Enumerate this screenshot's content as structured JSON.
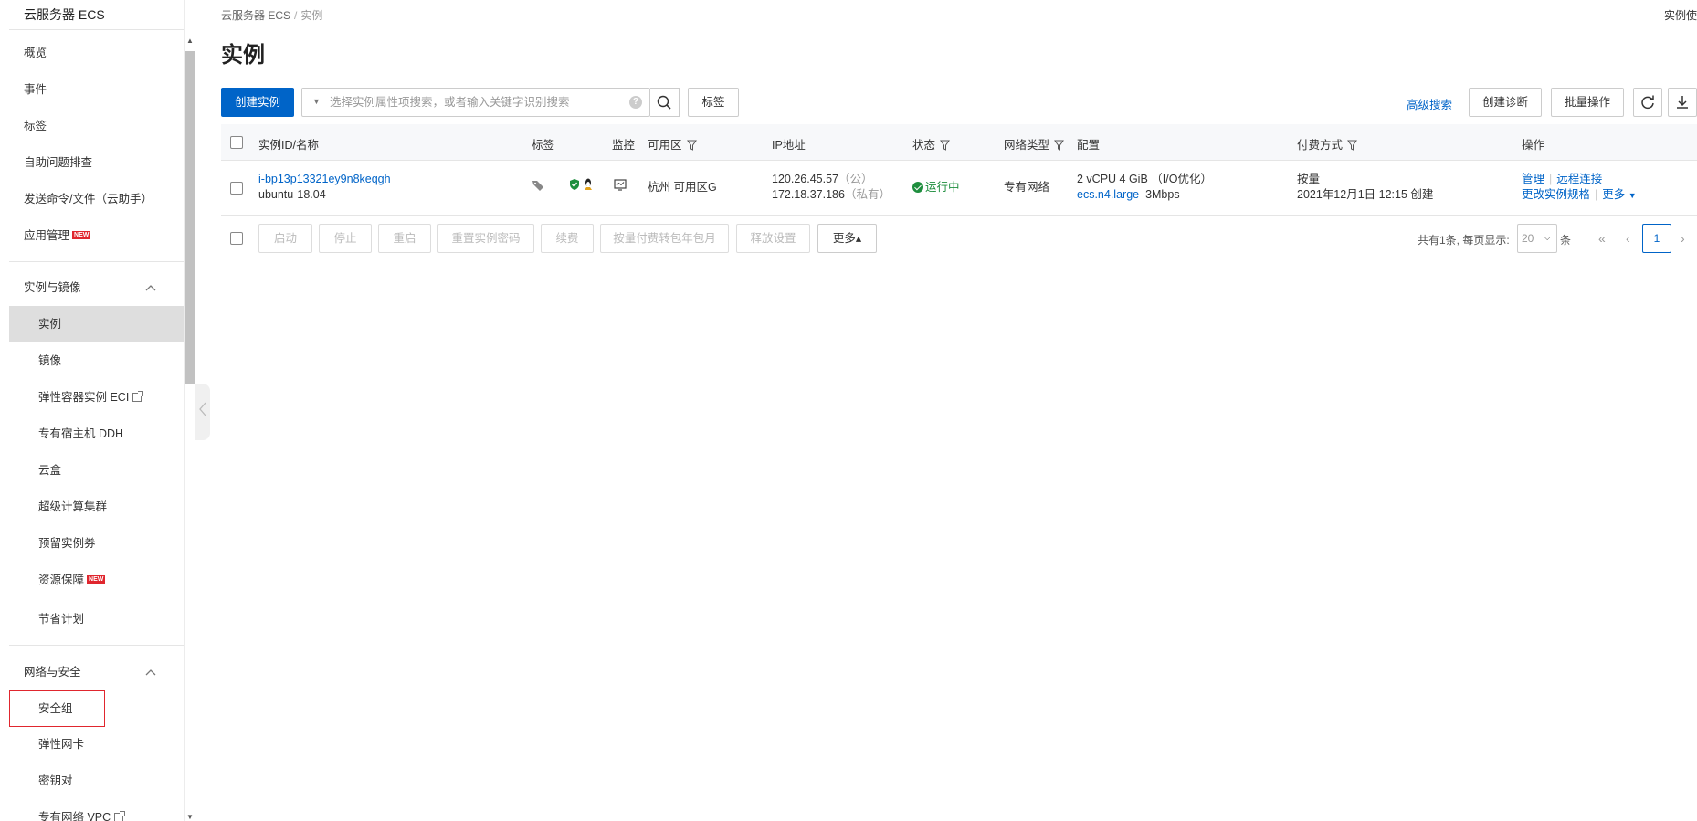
{
  "sidebar": {
    "title": "云服务器 ECS",
    "top_items": [
      {
        "label": "概览"
      },
      {
        "label": "事件"
      },
      {
        "label": "标签"
      },
      {
        "label": "自助问题排查"
      },
      {
        "label": "发送命令/文件（云助手）"
      },
      {
        "label": "应用管理",
        "badge": "NEW"
      }
    ],
    "group_instances": {
      "label": "实例与镜像",
      "items": [
        {
          "label": "实例",
          "active": true
        },
        {
          "label": "镜像"
        },
        {
          "label": "弹性容器实例 ECI",
          "external": true
        },
        {
          "label": "专有宿主机 DDH"
        },
        {
          "label": "云盒"
        },
        {
          "label": "超级计算集群"
        },
        {
          "label": "预留实例券"
        },
        {
          "label": "资源保障",
          "badge": "NEW"
        },
        {
          "label": "节省计划"
        }
      ]
    },
    "group_network": {
      "label": "网络与安全",
      "items": [
        {
          "label": "安全组",
          "highlighted": true
        },
        {
          "label": "弹性网卡"
        },
        {
          "label": "密钥对"
        },
        {
          "label": "专有网络 VPC",
          "external": true
        }
      ]
    }
  },
  "breadcrumb": {
    "root": "云服务器 ECS",
    "separator": "/",
    "current": "实例"
  },
  "top_right_text": "实例使",
  "page_title": "实例",
  "toolbar": {
    "create_label": "创建实例",
    "search_placeholder": "选择实例属性项搜索，或者输入关键字识别搜索",
    "tag_label": "标签",
    "advanced_search_label": "高级搜索",
    "diagnose_label": "创建诊断",
    "batch_label": "批量操作"
  },
  "table": {
    "columns": {
      "id_name": "实例ID/名称",
      "tags": "标签",
      "monitor": "监控",
      "zone": "可用区",
      "ip": "IP地址",
      "status": "状态",
      "network": "网络类型",
      "config": "配置",
      "billing": "付费方式",
      "actions": "操作"
    },
    "rows": [
      {
        "instance_id": "i-bp13p13321ey9n8keqgh",
        "name": "ubuntu-18.04",
        "zone": "杭州 可用区G",
        "public_ip": "120.26.45.57",
        "public_tag": "（公）",
        "private_ip": "172.18.37.186",
        "private_tag": "（私有）",
        "status": "运行中",
        "network": "专有网络",
        "config_line1": "2 vCPU 4 GiB （I/O优化）",
        "instance_type": "ecs.n4.large",
        "bandwidth": "3Mbps",
        "billing_type": "按量",
        "created": "2021年12月1日 12:15 创建",
        "actions": {
          "manage": "管理",
          "remote": "远程连接",
          "change_spec": "更改实例规格",
          "more": "更多"
        }
      }
    ]
  },
  "footer": {
    "buttons": [
      "启动",
      "停止",
      "重启",
      "重置实例密码",
      "续费",
      "按量付费转包年包月",
      "释放设置"
    ],
    "more_label": "更多▴",
    "total_text": "共有1条, 每页显示:",
    "page_size": "20",
    "unit": "条",
    "current_page": "1"
  },
  "colors": {
    "primary": "#0064c8",
    "running": "#1e8e3e",
    "badge": "#e0262e"
  }
}
